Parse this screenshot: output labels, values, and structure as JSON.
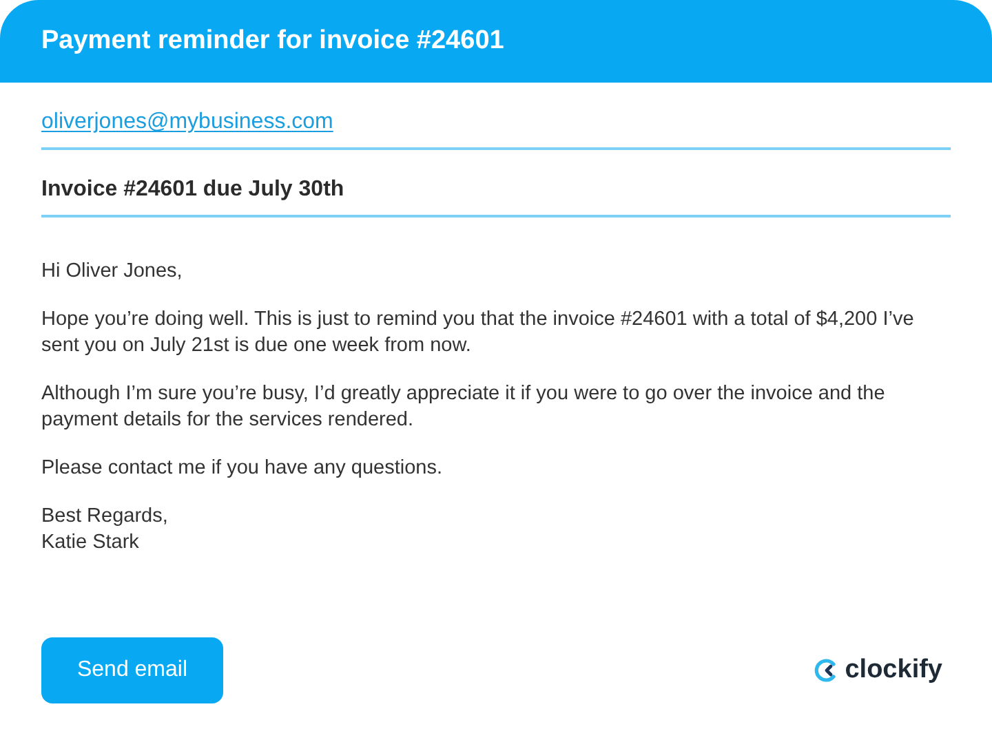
{
  "header": {
    "title": "Payment reminder for invoice #24601"
  },
  "recipient": {
    "value": "oliverjones@mybusiness.com"
  },
  "subject": {
    "value": "Invoice #24601 due July 30th"
  },
  "body": [
    "Hi Oliver Jones,",
    "Hope you’re doing well. This is just to remind you that the invoice #24601 with a total of $4,200 I’ve sent you on July 21st is due one week from now.",
    "Although I’m sure you’re busy, I’d greatly appreciate it if you were to go over the invoice and the payment details for the services rendered.",
    "Please contact me if you have any questions."
  ],
  "signature": [
    "Best Regards,",
    "Katie Stark"
  ],
  "send_button": {
    "label": "Send email"
  },
  "logo": {
    "text": "clockify"
  }
}
